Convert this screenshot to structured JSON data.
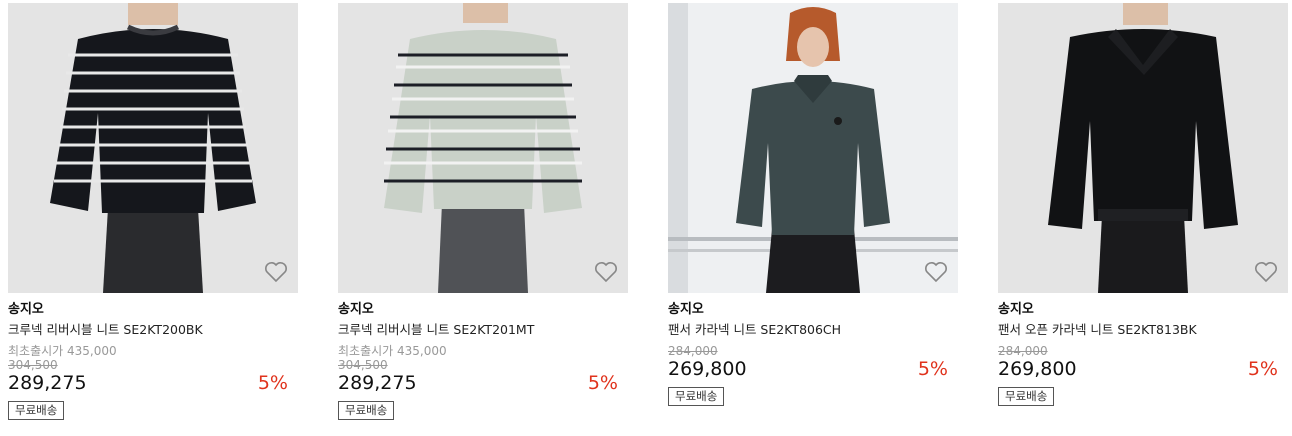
{
  "products": [
    {
      "brand": "송지오",
      "name": "크루넥 리버시블 니트 SE2KT200BK",
      "first_release_price": "최초출시가 435,000",
      "original_price": "304,500",
      "price": "289,275",
      "discount": "5%",
      "tag": "무료배송"
    },
    {
      "brand": "송지오",
      "name": "크루넥 리버시블 니트 SE2KT201MT",
      "first_release_price": "최초출시가 435,000",
      "original_price": "304,500",
      "price": "289,275",
      "discount": "5%",
      "tag": "무료배송"
    },
    {
      "brand": "송지오",
      "name": "팬서 카라넥 니트 SE2KT806CH",
      "original_price": "284,000",
      "price": "269,800",
      "discount": "5%",
      "tag": "무료배송"
    },
    {
      "brand": "송지오",
      "name": "팬서 오픈 카라넥 니트 SE2KT813BK",
      "original_price": "284,000",
      "price": "269,800",
      "discount": "5%",
      "tag": "무료배송"
    }
  ],
  "icons": {
    "wishlist": "heart-outline-icon"
  },
  "colors": {
    "discount": "#e0331d",
    "muted": "#999999"
  }
}
